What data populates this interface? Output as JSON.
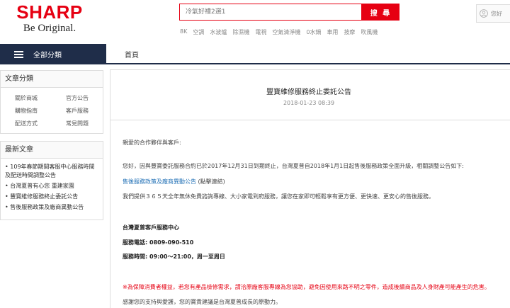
{
  "header": {
    "brand": "SHARP",
    "tagline": "Be Original.",
    "search_placeholder": "冷氣好禮2選1",
    "search_button": "搜 尋",
    "hot_words": [
      "8K",
      "空調",
      "水波爐",
      "除濕機",
      "電視",
      "空氣清淨機",
      "0水鍋",
      "車用",
      "按摩",
      "吹風機"
    ],
    "user_text": "您好"
  },
  "nav": {
    "category_label": "全部分類",
    "home_label": "首頁"
  },
  "sidebar": {
    "categories_title": "文章分類",
    "categories": [
      "關於商城",
      "官方公告",
      "購物指南",
      "客戶服務",
      "配送方式",
      "常見問題"
    ],
    "news_title": "最新文章",
    "news": [
      "• 109年春節期間客服中心服務時間及配送時間調整公告",
      "• 台灣夏普有心您 重建家園",
      "• 豐寶維修服務終止委託公告",
      "• 售後服務政策及廠商異動公告"
    ]
  },
  "article": {
    "title": "豐寶維修服務終止委託公告",
    "date": "2018-01-23 08:39",
    "greeting": "親愛的合作夥伴與客戶:",
    "p1": "您好，因與豐寶委託服務合約已於2017年12月31日到期終止，台灣夏普自2018年1月1日起售後服務政策全面升級，相關調整公告如下:",
    "link_text": "售後服務政策及廠商異動公告",
    "link_suffix": " (點擊連結)",
    "p2": "我們提供３６５天全年無休免費諮詢專線、大小家電到府服務，讓您在家即可輕鬆享有更方便、更快速、更安心的售後服務。",
    "service_center": "台灣夏普客戶服務中心",
    "phone_label": "服務電話:",
    "phone": "0809-090-510",
    "hours_label": "服務時間:",
    "hours": "09:00～21:00，周一至周日",
    "warning": "※為保障消費者權益，若您有產品檢修需求，請洽原廠客服專線為您協助，避免因使用來路不明之零件，造成後續商品及人身財產可能產生的危害。",
    "closing": "感謝您的支持與愛護，您的寶貴建議是台灣夏普成長的原動力。"
  }
}
